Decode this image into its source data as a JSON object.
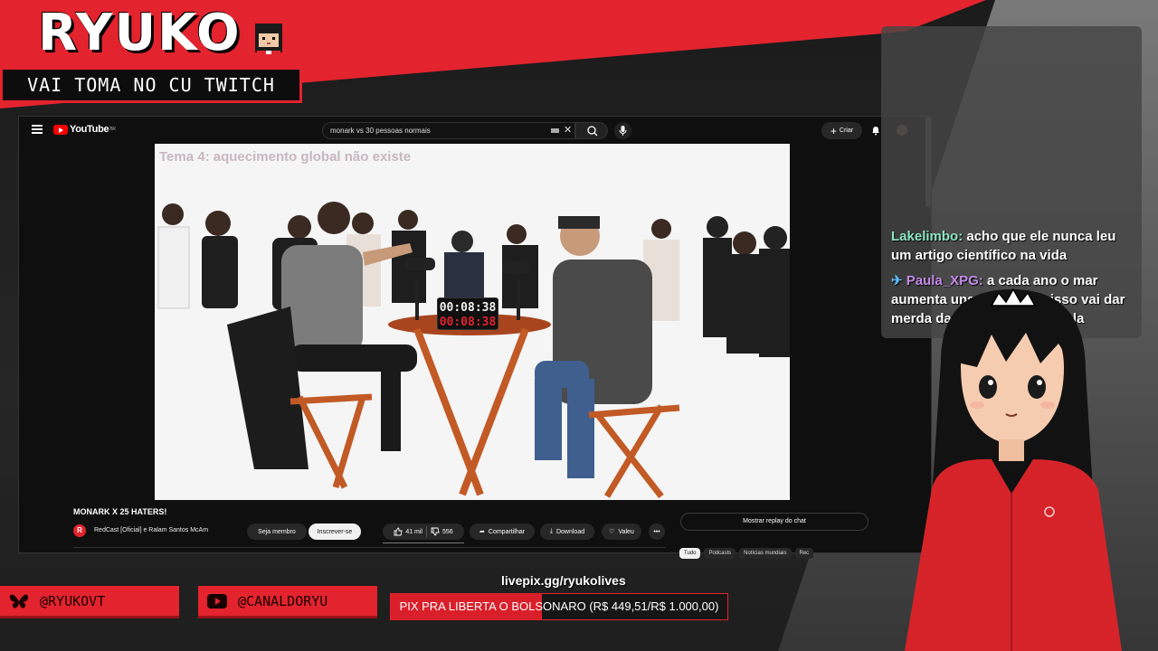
{
  "overlay": {
    "brand_title": "RYUKO",
    "brand_subtitle": "VAI TOMA NO CU TWITCH",
    "socials": [
      {
        "icon": "butterfly-icon",
        "handle": "@RYUKOVT"
      },
      {
        "icon": "youtube-icon",
        "handle": "@CANALDORYU"
      }
    ],
    "pix_url": "livepix.gg/ryukolives",
    "goal": {
      "text": "PIX PRA LIBERTA O BOLSONARO (R$ 449,51/R$ 1.000,00)",
      "current": 449.51,
      "target": 1000.0,
      "fill_color": "#d91f2a"
    },
    "accent_color": "#e3232e"
  },
  "youtube": {
    "logo_text": "YouTube",
    "logo_region": "BR",
    "search_value": "monark vs 30 pessoas normais",
    "create_label": "Criar",
    "video": {
      "caption": "Tema 4: aquecimento global não existe",
      "timer_top": "00:08:38",
      "timer_bottom": "00:08:38"
    },
    "title": "MONARK X 25 HATERS!",
    "channel_initial": "R",
    "channel": "RedCast [Oficial] e Ralam Santos McAm",
    "member_label": "Seja membro",
    "subscribe_label": "Inscrever-se",
    "likes": "41 mil",
    "dislikes": "556",
    "share_label": "Compartilhar",
    "download_label": "Download",
    "thanks_label": "Valeu",
    "more_label": "•••",
    "chat_replay_label": "Mostrar replay do chat",
    "chips": [
      "Tudo",
      "Podcasts",
      "Notícias mundiais",
      "Rec"
    ]
  },
  "chat": {
    "messages": [
      {
        "user": "Lakelimbo",
        "text": "acho que ele nunca leu um artigo científico na vida",
        "user_color": "#8de6c2"
      },
      {
        "user": "Paula_XPG",
        "text": "a cada ano o mar aumenta uns 4 metros e isso vai dar merda daqui uns 500 anos sla",
        "user_color": "#c58be8",
        "badge": "pin-icon"
      }
    ]
  }
}
